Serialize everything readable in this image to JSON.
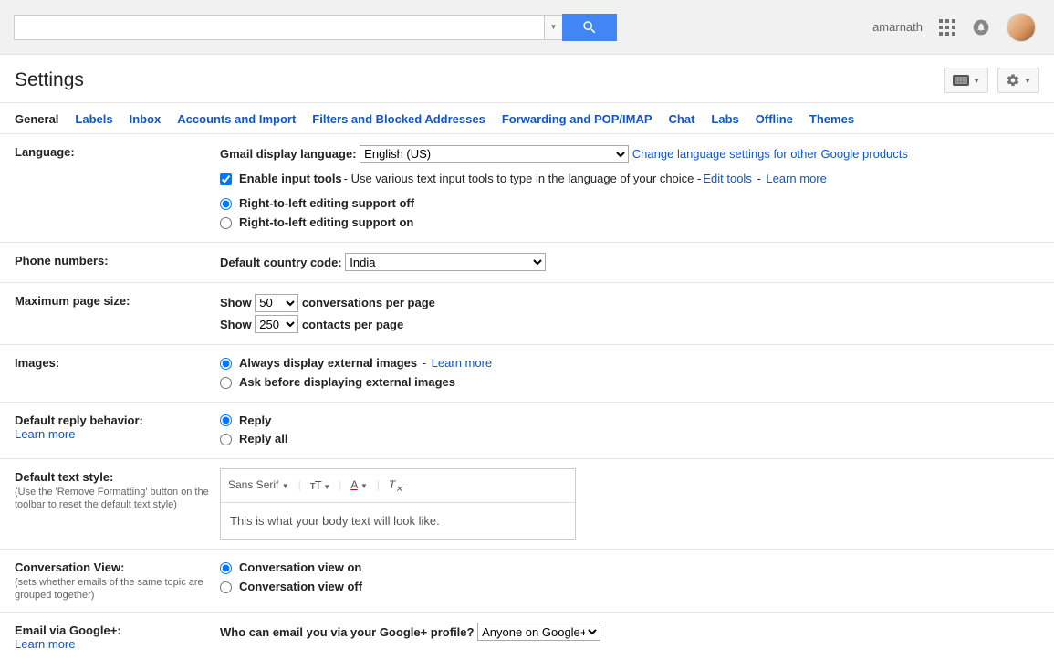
{
  "header": {
    "username": "amarnath"
  },
  "title": "Settings",
  "tabs": [
    "General",
    "Labels",
    "Inbox",
    "Accounts and Import",
    "Filters and Blocked Addresses",
    "Forwarding and POP/IMAP",
    "Chat",
    "Labs",
    "Offline",
    "Themes"
  ],
  "language": {
    "label": "Language:",
    "display_label": "Gmail display language:",
    "display_value": "English (US)",
    "change_link": "Change language settings for other Google products",
    "enable_input_label": "Enable input tools",
    "enable_input_desc": " - Use various text input tools to type in the language of your choice - ",
    "edit_tools": "Edit tools",
    "learn_more": "Learn more",
    "rtl_off": "Right-to-left editing support off",
    "rtl_on": "Right-to-left editing support on"
  },
  "phone": {
    "label": "Phone numbers:",
    "default_label": "Default country code:",
    "value": "India"
  },
  "pagesize": {
    "label": "Maximum page size:",
    "show": "Show",
    "conv_value": "50",
    "conv_suffix": "conversations per page",
    "contact_value": "250",
    "contact_suffix": "contacts per page"
  },
  "images": {
    "label": "Images:",
    "always": "Always display external images",
    "learn_more": "Learn more",
    "ask": "Ask before displaying external images"
  },
  "reply": {
    "label": "Default reply behavior:",
    "learn_more": "Learn more",
    "reply": "Reply",
    "reply_all": "Reply all"
  },
  "textstyle": {
    "label": "Default text style:",
    "sub": "(Use the 'Remove Formatting' button on the toolbar to reset the default text style)",
    "font": "Sans Serif",
    "preview": "This is what your body text will look like."
  },
  "conversation": {
    "label": "Conversation View:",
    "sub": "(sets whether emails of the same topic are grouped together)",
    "on": "Conversation view on",
    "off": "Conversation view off"
  },
  "gplus": {
    "label": "Email via Google+:",
    "learn_more": "Learn more",
    "question": "Who can email you via your Google+ profile?",
    "value": "Anyone on Google+"
  }
}
